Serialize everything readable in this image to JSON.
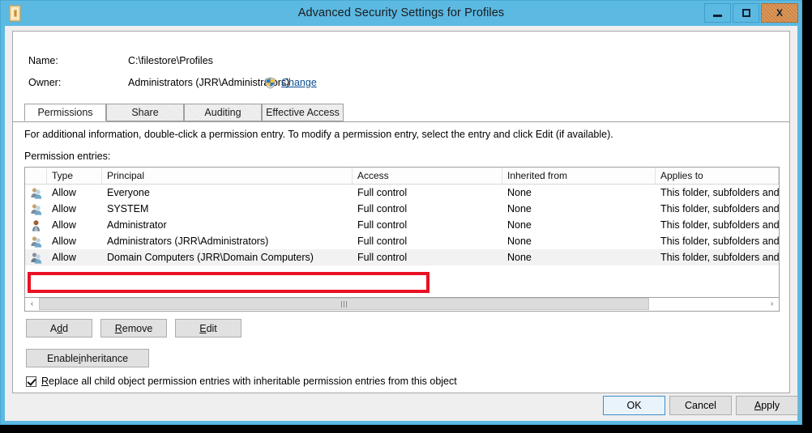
{
  "window": {
    "title": "Advanced Security Settings for Profiles",
    "icon": "folder-icon",
    "minimize_label": "",
    "maximize_label": "",
    "close_label": "X",
    "frame_color": "#5cb9e2",
    "close_color": "#d08441"
  },
  "header": {
    "name_label": "Name:",
    "name_value": "C:\\filestore\\Profiles",
    "owner_label": "Owner:",
    "owner_value": "Administrators (JRR\\Administrators)",
    "change_link": "Change",
    "shield_icon": "uac-shield-icon",
    "link_color": "#0b4d8f"
  },
  "tabs": [
    {
      "label": "Permissions",
      "active": true
    },
    {
      "label": "Share",
      "active": false
    },
    {
      "label": "Auditing",
      "active": false
    },
    {
      "label": "Effective Access",
      "active": false
    }
  ],
  "body": {
    "info_text": "For additional information, double-click a permission entry. To modify a permission entry, select the entry and click Edit (if available).",
    "entries_label": "Permission entries:"
  },
  "table": {
    "columns": [
      "",
      "Type",
      "Principal",
      "Access",
      "Inherited from",
      "Applies to"
    ],
    "rows": [
      {
        "icon": "group-icon",
        "type": "Allow",
        "principal": "Everyone",
        "access": "Full control",
        "inherited_from": "None",
        "applies_to": "This folder, subfolders and fi",
        "selected": false
      },
      {
        "icon": "group-icon",
        "type": "Allow",
        "principal": "SYSTEM",
        "access": "Full control",
        "inherited_from": "None",
        "applies_to": "This folder, subfolders and fi",
        "selected": false
      },
      {
        "icon": "user-icon",
        "type": "Allow",
        "principal": "Administrator",
        "access": "Full control",
        "inherited_from": "None",
        "applies_to": "This folder, subfolders and fi",
        "selected": false
      },
      {
        "icon": "group-icon",
        "type": "Allow",
        "principal": "Administrators (JRR\\Administrators)",
        "access": "Full control",
        "inherited_from": "None",
        "applies_to": "This folder, subfolders and fi",
        "selected": false
      },
      {
        "icon": "group-icon",
        "type": "Allow",
        "principal": "Domain Computers (JRR\\Domain Computers)",
        "access": "Full control",
        "inherited_from": "None",
        "applies_to": "This folder, subfolders and fi",
        "selected": true
      }
    ]
  },
  "scrollbar": {
    "left_arrow": "‹",
    "right_arrow": "›"
  },
  "actions": {
    "add": "Add",
    "add_prefix": "A",
    "add_accel": "d",
    "add_suffix": "d",
    "remove_accel": "R",
    "remove_suffix": "emove",
    "edit_accel": "E",
    "edit_suffix": "dit",
    "inherit_prefix": "Enable ",
    "inherit_accel": "i",
    "inherit_suffix": "nheritance",
    "replace_accel": "R",
    "replace_prefix": "",
    "replace_suffix": "eplace all child object permission entries with inheritable permission entries from this object",
    "replace_checked": true
  },
  "footer": {
    "ok": "OK",
    "cancel": "Cancel",
    "apply_accel": "A",
    "apply_suffix": "pply"
  },
  "annotation": {
    "highlight_color": "#e81123",
    "highlight_target": "Domain Computers (JRR\\Domain Computers)"
  }
}
